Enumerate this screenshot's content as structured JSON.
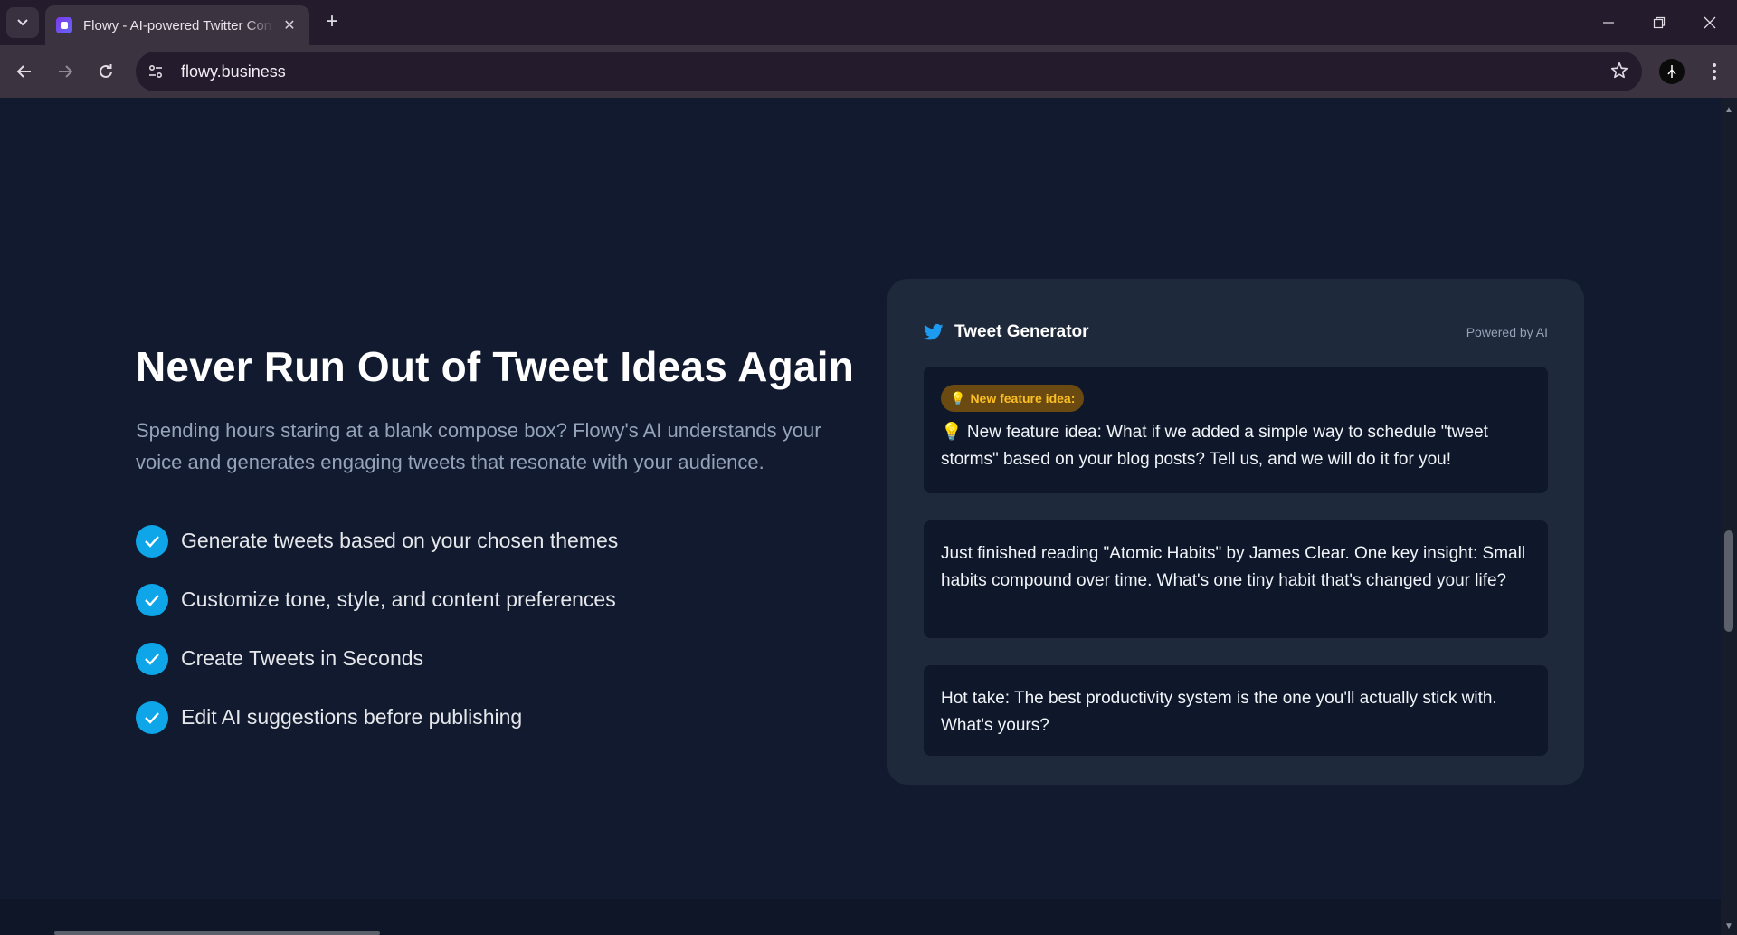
{
  "browser": {
    "tab_title": "Flowy - AI-powered Twitter Content Generator",
    "tab_close": "✕",
    "new_tab": "+",
    "url": "flowy.business"
  },
  "hero": {
    "title": "Never Run Out of Tweet Ideas Again",
    "subtitle": "Spending hours staring at a blank compose box? Flowy's AI understands your voice and generates engaging tweets that resonate with your audience.",
    "features": [
      "Generate tweets based on your chosen themes",
      "Customize tone, style, and content preferences",
      "Create Tweets in Seconds",
      "Edit AI suggestions before publishing"
    ]
  },
  "generator": {
    "title": "Tweet Generator",
    "powered_by": "Powered by AI",
    "badge": "New feature idea:",
    "tweets": [
      "💡 New feature idea: What if we added a simple way to schedule \"tweet storms\" based on your blog posts? Tell us, and we will do it for you!",
      "Just finished reading \"Atomic Habits\" by James Clear. One key insight: Small habits compound over time. What's one tiny habit that's changed your life?",
      "Hot take: The best productivity system is the one you'll actually stick with. What's yours?"
    ]
  },
  "colors": {
    "accent": "#0ea5e9",
    "twitter_blue": "#1d9bf0",
    "badge_text": "#fbbf24",
    "page_bg": "#111a2e",
    "card_bg": "#1e293b"
  },
  "icons": [
    "tab-list-icon",
    "favicon-icon",
    "close-icon",
    "plus-icon",
    "minimize-icon",
    "restore-icon",
    "back-icon",
    "forward-icon",
    "reload-icon",
    "site-info-icon",
    "star-icon",
    "profile-icon",
    "menu-icon",
    "twitter-bird-icon",
    "check-icon",
    "lightbulb-icon"
  ]
}
